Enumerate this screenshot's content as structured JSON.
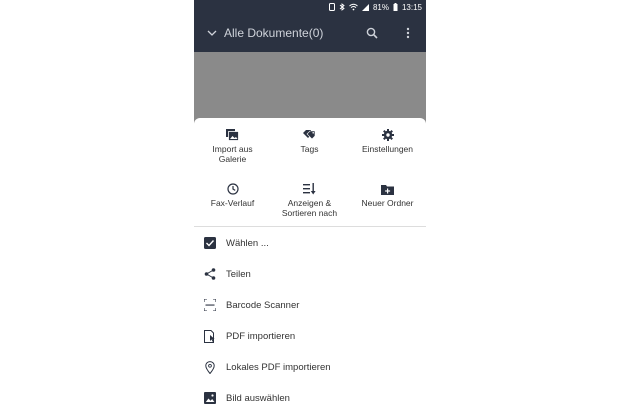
{
  "status_bar": {
    "battery_percent": "81%",
    "time": "13:15"
  },
  "app_bar": {
    "title": "Alle Dokumente(0)",
    "icons": [
      "chevron-down-icon",
      "search-icon",
      "more-vert-icon"
    ]
  },
  "colors": {
    "app_bar": "#2b3241",
    "scrim": "#8a8a8a",
    "sheet": "#ffffff",
    "text": "#333333"
  },
  "grid": [
    {
      "label": "Import aus Galerie",
      "icon": "gallery-import-icon"
    },
    {
      "label": "Tags",
      "icon": "tag-icon"
    },
    {
      "label": "Einstellungen",
      "icon": "settings-gear-icon"
    },
    {
      "label": "Fax-Verlauf",
      "icon": "clock-history-icon"
    },
    {
      "label": "Anzeigen & Sortieren nach",
      "icon": "sort-icon"
    },
    {
      "label": "Neuer Ordner",
      "icon": "new-folder-icon"
    }
  ],
  "list": [
    {
      "label": "Wählen ...",
      "icon": "checkbox-checked-icon"
    },
    {
      "label": "Teilen",
      "icon": "share-icon"
    },
    {
      "label": "Barcode Scanner",
      "icon": "barcode-scanner-icon"
    },
    {
      "label": "PDF importieren",
      "icon": "pdf-import-icon"
    },
    {
      "label": "Lokales PDF importieren",
      "icon": "local-pdf-icon"
    },
    {
      "label": "Bild auswählen",
      "icon": "image-icon"
    }
  ]
}
